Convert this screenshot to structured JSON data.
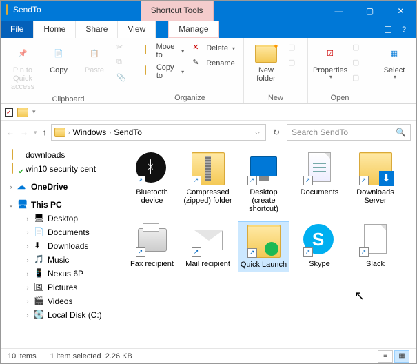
{
  "window": {
    "title": "SendTo",
    "contextual_tab": "Shortcut Tools"
  },
  "tabs": {
    "file": "File",
    "home": "Home",
    "share": "Share",
    "view": "View",
    "manage": "Manage"
  },
  "ribbon": {
    "clipboard": {
      "pin": "Pin to Quick access",
      "copy": "Copy",
      "paste": "Paste",
      "label": "Clipboard"
    },
    "organize": {
      "moveto": "Move to",
      "copyto": "Copy to",
      "delete": "Delete",
      "rename": "Rename",
      "label": "Organize"
    },
    "new": {
      "newfolder": "New folder",
      "label": "New"
    },
    "open": {
      "properties": "Properties",
      "label": "Open"
    },
    "select": {
      "select": "Select",
      "label": ""
    }
  },
  "address": {
    "segments": [
      "Windows",
      "SendTo"
    ],
    "search_placeholder": "Search SendTo"
  },
  "navpane": {
    "quick": [
      {
        "label": "downloads",
        "icon": "folder"
      },
      {
        "label": "win10 security cent",
        "icon": "folder-check"
      }
    ],
    "onedrive": "OneDrive",
    "thispc": {
      "label": "This PC",
      "children": [
        {
          "label": "Desktop",
          "icon": "monitor"
        },
        {
          "label": "Documents",
          "icon": "doc"
        },
        {
          "label": "Downloads",
          "icon": "download"
        },
        {
          "label": "Music",
          "icon": "music"
        },
        {
          "label": "Nexus 6P",
          "icon": "phone"
        },
        {
          "label": "Pictures",
          "icon": "picture"
        },
        {
          "label": "Videos",
          "icon": "video"
        },
        {
          "label": "Local Disk (C:)",
          "icon": "disk"
        }
      ]
    }
  },
  "items": [
    {
      "label": "Bluetooth device",
      "icon": "bluetooth",
      "selected": false
    },
    {
      "label": "Compressed (zipped) folder",
      "icon": "zip",
      "selected": false
    },
    {
      "label": "Desktop (create shortcut)",
      "icon": "desktop",
      "selected": false
    },
    {
      "label": "Documents",
      "icon": "documents",
      "selected": false
    },
    {
      "label": "Downloads Server",
      "icon": "folder-down",
      "selected": false
    },
    {
      "label": "Fax recipient",
      "icon": "fax",
      "selected": false
    },
    {
      "label": "Mail recipient",
      "icon": "mail",
      "selected": false
    },
    {
      "label": "Quick Launch",
      "icon": "quicklaunch",
      "selected": true
    },
    {
      "label": "Skype",
      "icon": "skype",
      "selected": false
    },
    {
      "label": "Slack",
      "icon": "slack",
      "selected": false
    }
  ],
  "status": {
    "count": "10 items",
    "selection": "1 item selected",
    "size": "2.26 KB"
  }
}
